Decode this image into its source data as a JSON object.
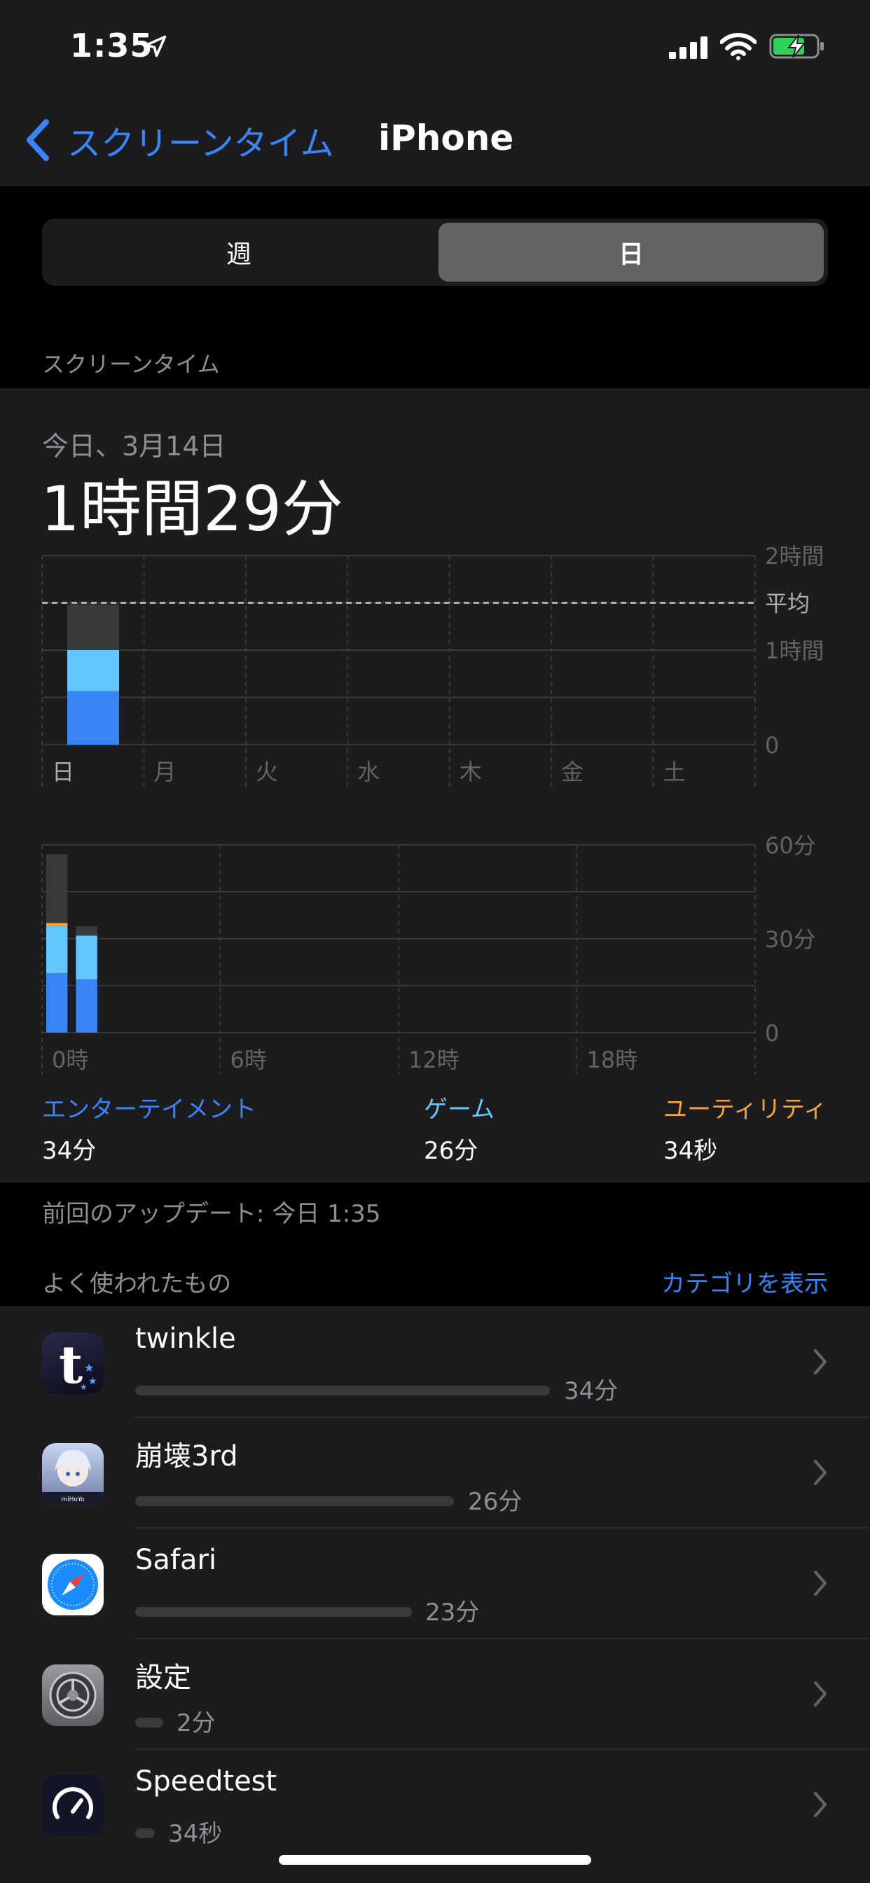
{
  "status_bar": {
    "time": "1:35"
  },
  "nav": {
    "back_label": "スクリーンタイム",
    "title": "iPhone"
  },
  "segment": {
    "week": "週",
    "day": "日",
    "selected": "day"
  },
  "section_screen_time": "スクリーンタイム",
  "summary": {
    "date": "今日、3月14日",
    "total": "1時間29分"
  },
  "chart_data": [
    {
      "type": "bar",
      "categories": [
        "日",
        "月",
        "火",
        "水",
        "木",
        "金",
        "土"
      ],
      "y_tick_labels": [
        "2時間",
        "1時間",
        "0"
      ],
      "average_label": "平均",
      "unit": "minutes",
      "ylim": [
        0,
        120
      ],
      "average": 90,
      "series": [
        {
          "name": "エンターテイメント",
          "color": "#3a85f6",
          "values": [
            34,
            0,
            0,
            0,
            0,
            0,
            0
          ]
        },
        {
          "name": "ゲーム",
          "color": "#64c8ff",
          "values": [
            26,
            0,
            0,
            0,
            0,
            0,
            0
          ]
        },
        {
          "color": "#3a3a3c",
          "values": [
            29,
            0,
            0,
            0,
            0,
            0,
            0
          ]
        }
      ]
    },
    {
      "type": "bar",
      "categories": [
        "0",
        "1",
        "2",
        "3",
        "4",
        "5",
        "6",
        "7",
        "8",
        "9",
        "10",
        "11",
        "12",
        "13",
        "14",
        "15",
        "16",
        "17",
        "18",
        "19",
        "20",
        "21",
        "22",
        "23"
      ],
      "x_tick_labels": [
        "0時",
        "6時",
        "12時",
        "18時"
      ],
      "y_tick_labels": [
        "60分",
        "30分",
        "0"
      ],
      "unit": "minutes",
      "ylim": [
        0,
        60
      ],
      "series": [
        {
          "name": "エンターテイメント",
          "color": "#3a85f6",
          "values": [
            19,
            17,
            0,
            0,
            0,
            0,
            0,
            0,
            0,
            0,
            0,
            0,
            0,
            0,
            0,
            0,
            0,
            0,
            0,
            0,
            0,
            0,
            0,
            0
          ]
        },
        {
          "name": "ゲーム",
          "color": "#64c8ff",
          "values": [
            15,
            14,
            0,
            0,
            0,
            0,
            0,
            0,
            0,
            0,
            0,
            0,
            0,
            0,
            0,
            0,
            0,
            0,
            0,
            0,
            0,
            0,
            0,
            0
          ]
        },
        {
          "name": "ユーティリティ",
          "color": "#f2a33a",
          "values": [
            1,
            0,
            0,
            0,
            0,
            0,
            0,
            0,
            0,
            0,
            0,
            0,
            0,
            0,
            0,
            0,
            0,
            0,
            0,
            0,
            0,
            0,
            0,
            0
          ]
        },
        {
          "color": "#3a3a3c",
          "values": [
            22,
            3,
            0,
            0,
            0,
            0,
            0,
            0,
            0,
            0,
            0,
            0,
            0,
            0,
            0,
            0,
            0,
            0,
            0,
            0,
            0,
            0,
            0,
            0
          ]
        }
      ]
    }
  ],
  "legend": [
    {
      "name": "エンターテイメント",
      "value": "34分",
      "color": "#3a85f6"
    },
    {
      "name": "ゲーム",
      "value": "26分",
      "color": "#64c8ff"
    },
    {
      "name": "ユーティリティ",
      "value": "34秒",
      "color": "#f2a33a"
    }
  ],
  "last_update": "前回のアップデート: 今日 1:35",
  "most_used": {
    "title": "よく使われたもの",
    "show_categories": "カテゴリを表示"
  },
  "apps": [
    {
      "name": "twinkle",
      "time": "34分",
      "fraction": 1.0,
      "icon": "twinkle-icon"
    },
    {
      "name": "崩壊3rd",
      "time": "26分",
      "fraction": 0.76,
      "icon": "honkai-icon"
    },
    {
      "name": "Safari",
      "time": "23分",
      "fraction": 0.66,
      "icon": "safari-icon"
    },
    {
      "name": "設定",
      "time": "2分",
      "fraction": 0.06,
      "icon": "settings-icon"
    },
    {
      "name": "Speedtest",
      "time": "34秒",
      "fraction": 0.04,
      "icon": "speedtest-icon"
    }
  ]
}
